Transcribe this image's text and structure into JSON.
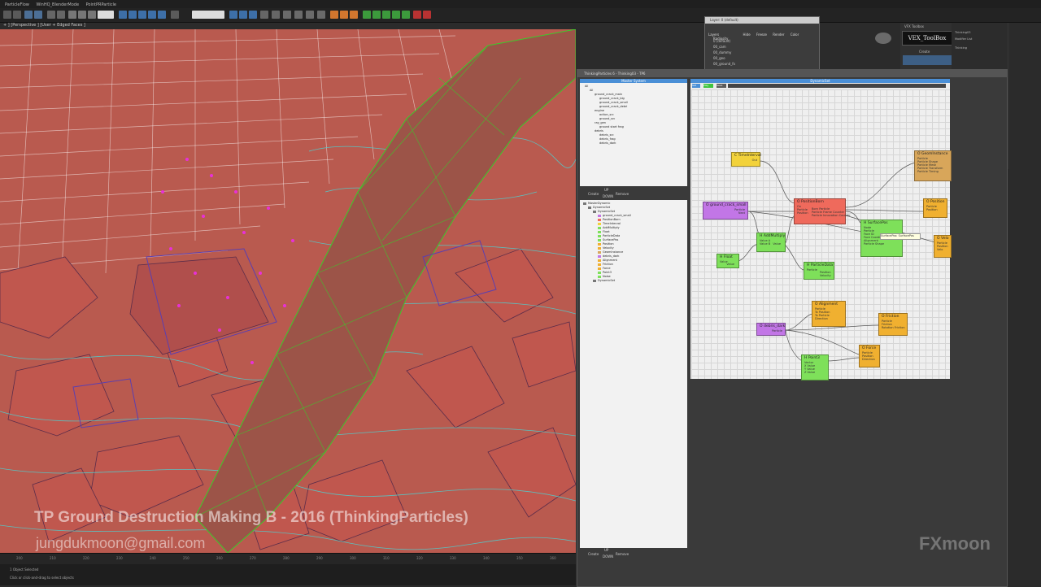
{
  "menubar": {
    "items": [
      "ParticleFlow",
      "WinHQ_BlenderMode",
      "PointPRParticle"
    ]
  },
  "viewport": {
    "label": "+ ] [Perspective ] [User + Edged Faces ]",
    "overlay_title": "TP Ground Destruction Making B - 2016 (ThinkingParticles)",
    "overlay_email": "jungdukmoon@gmail.com"
  },
  "timeline": {
    "ticks": [
      "200",
      "210",
      "220",
      "230",
      "240",
      "250",
      "260",
      "270",
      "280",
      "290",
      "300",
      "310",
      "320",
      "330",
      "340",
      "350",
      "360"
    ]
  },
  "statusbar": {
    "line1": "1 Object Selected",
    "line2": "Click or click-and-drag to select objects"
  },
  "layer_window": {
    "title": "Layer: 0 (default)",
    "columns": [
      "Layers",
      "Hide",
      "Freeze",
      "Render",
      "Color",
      "Radiosity"
    ],
    "rows": [
      "0 (default)",
      "00_cam",
      "00_dummy",
      "00_geo",
      "00_ground_fx"
    ]
  },
  "tp_window": {
    "title": "ThinkingParticles 6 - Thinking03 - TP6",
    "master_system_header": "Master System",
    "master_tree": [
      "All",
      "All",
      "ground_crack_main",
      "ground_crack_big",
      "ground_crack_small",
      "ground_crack_debri",
      "engine",
      "action_src",
      "ground_src",
      "ray_gen",
      "ground start frag",
      "debris",
      "debris_src",
      "debris_frag",
      "debris_dark"
    ],
    "ms_buttons": [
      "Create",
      "UP",
      "DOWN",
      "Remove"
    ],
    "dyn_list": [
      "MasterDynamic",
      "DynamicSet",
      "DynamicSet",
      "ground_crack_small",
      "PositionBorn",
      "TimeInterval",
      "AddMultiply",
      "Float",
      "ParticleData",
      "SurfacePos",
      "Position",
      "Velocity",
      "GeomInstance",
      "debris_dark",
      "Alignment",
      "Friction",
      "Force",
      "Point3",
      "Noise",
      "DynamicSet"
    ],
    "bottom_buttons": [
      "Create",
      "UP",
      "DOWN",
      "Remove"
    ],
    "dyn_header": "DynamicSet",
    "dyn_tabs": [
      "Set",
      "Play",
      "Save"
    ]
  },
  "nodes": {
    "time_interval": {
      "title": "C TimeInterval",
      "ports": [
        "Out"
      ]
    },
    "geom_instance": {
      "title": "O GeomInstance",
      "ports": [
        "Particle",
        "Particle Shape",
        "Particle Mesh",
        "Particle Transform",
        "Particle Timing"
      ]
    },
    "ground_crack_small": {
      "title": "O ground_crack_small",
      "ports": [
        "Particle",
        "Next"
      ]
    },
    "position_born": {
      "title": "O PositionBorn",
      "ports": [
        "On",
        "Particle",
        "Position",
        "Born Particle",
        "Particle Frame Counter",
        "Particle Innovation Counter"
      ]
    },
    "position": {
      "title": "O Position",
      "ports": [
        "Particle",
        "Position"
      ]
    },
    "surface_pos": {
      "title": "H SurfacePos",
      "ports": [
        "Node",
        "Particle",
        "Face ID",
        "Face Coordinates",
        "Alignment",
        "Particle Shape"
      ],
      "tooltip": "SurfacePos: SurfacePos"
    },
    "velocity": {
      "title": "O Velo",
      "ports": [
        "Particle",
        "Position",
        "Velo"
      ]
    },
    "add_multiply": {
      "title": "H AddMultiply",
      "ports": [
        "Value A",
        "Value B",
        "Value"
      ]
    },
    "float": {
      "title": "H Float",
      "ports": [
        "Value",
        "Value"
      ]
    },
    "particle_data": {
      "title": "H ParticleData",
      "ports": [
        "Particle",
        "Position",
        "Velocity"
      ]
    },
    "alignment": {
      "title": "O Alignment",
      "ports": [
        "Particle",
        "To Position",
        "To Particle",
        "Direction"
      ]
    },
    "debris_dark": {
      "title": "O debris_dark",
      "ports": [
        "Particle"
      ]
    },
    "friction": {
      "title": "O Friction",
      "ports": [
        "Particle",
        "Friction",
        "Rotation Friction"
      ]
    },
    "point3": {
      "title": "H Point3",
      "ports": [
        "Vector",
        "X Value",
        "Y Value",
        "Z Value"
      ]
    },
    "force": {
      "title": "O Force",
      "ports": [
        "Particle",
        "Position",
        "Direction"
      ]
    }
  },
  "right_panel": {
    "vex_label": "VEX_ToolBox",
    "header": "VFX Toolbox",
    "create_label": "Create",
    "items": [
      "Thinking03",
      "Modifier List",
      "Thinking",
      "ground_crack_main",
      "ground_crack_big",
      "ground_crack_small",
      "ground_crack_debri",
      "engine",
      "ground_src",
      "ray_gen",
      "ground start frag",
      "debris",
      "debris_frag",
      "debris_dark",
      "ParticleData",
      "DataChannelGroup"
    ]
  },
  "watermark": "FXmoon",
  "colors": {
    "viewport_bg": "#b95a4f",
    "node_green": "#7ee05a",
    "node_orange": "#f0b030",
    "node_purple": "#c276e6",
    "node_red": "#ef6a5c",
    "node_yellow": "#f2d23a",
    "node_tan": "#d8a65a",
    "header_blue": "#4a8fd6"
  }
}
